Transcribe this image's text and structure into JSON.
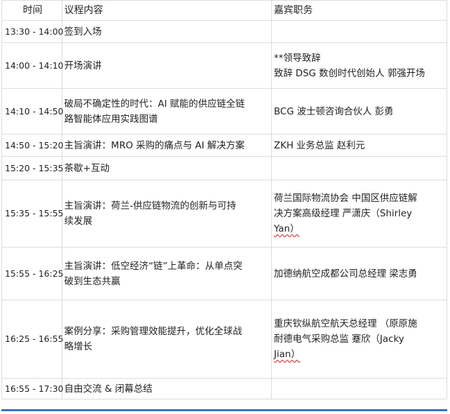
{
  "headers": {
    "time": "时间",
    "content": "议程内容",
    "guest": "嘉宾职务"
  },
  "rows": [
    {
      "time": "13:30 - 14:00",
      "content": [
        "签到入场"
      ],
      "guest": []
    },
    {
      "time": "14:00 - 14:10",
      "content": [
        "开场演讲"
      ],
      "guest": [
        "**领导致辞",
        "致辞 DSG 数创时代创始人 郭强开场"
      ]
    },
    {
      "time": "14:10 - 14:50",
      "content": [
        "破局不确定性的时代：AI 赋能的供应链全链",
        "路智能体应用实践图谱"
      ],
      "guest": [
        "BCG 波士顿咨询合伙人 彭勇"
      ]
    },
    {
      "time": "14:50 - 15:20",
      "content": [
        "主旨演讲：MRO 采购的痛点与 AI 解决方案"
      ],
      "guest": [
        "ZKH 业务总监 赵利元"
      ]
    },
    {
      "time": "15:20 - 15:35",
      "content": [
        "茶歇+互动"
      ],
      "guest": []
    },
    {
      "time": "15:35 - 15:55",
      "content": [
        "主旨演讲：荷兰-供应链物流的创新与可持",
        "续发展"
      ],
      "guest": [
        "荷兰国际物流协会 中国区供应链解",
        "决方案高级经理 严潇庆（Shirley",
        "Yan）"
      ]
    },
    {
      "time": "15:55 - 16:25",
      "content": [
        "主旨演讲：低空经济“链”上革命：从单点突",
        "破到生态共赢"
      ],
      "guest": [
        "加德纳航空成都公司总经理 梁志勇"
      ]
    },
    {
      "time": "16:25 - 16:55",
      "content": [
        "案例分享：采购管理效能提升，优化全球战",
        "略增长"
      ],
      "guest": [
        "重庆钦纵航空航天总经理 （原原施",
        "耐德电气采购总监 蹇欣（Jacky",
        "Jian）"
      ]
    },
    {
      "time": "16:55 - 17:30",
      "content": [
        "自由交流 & 闭幕总结"
      ],
      "guest": []
    }
  ]
}
